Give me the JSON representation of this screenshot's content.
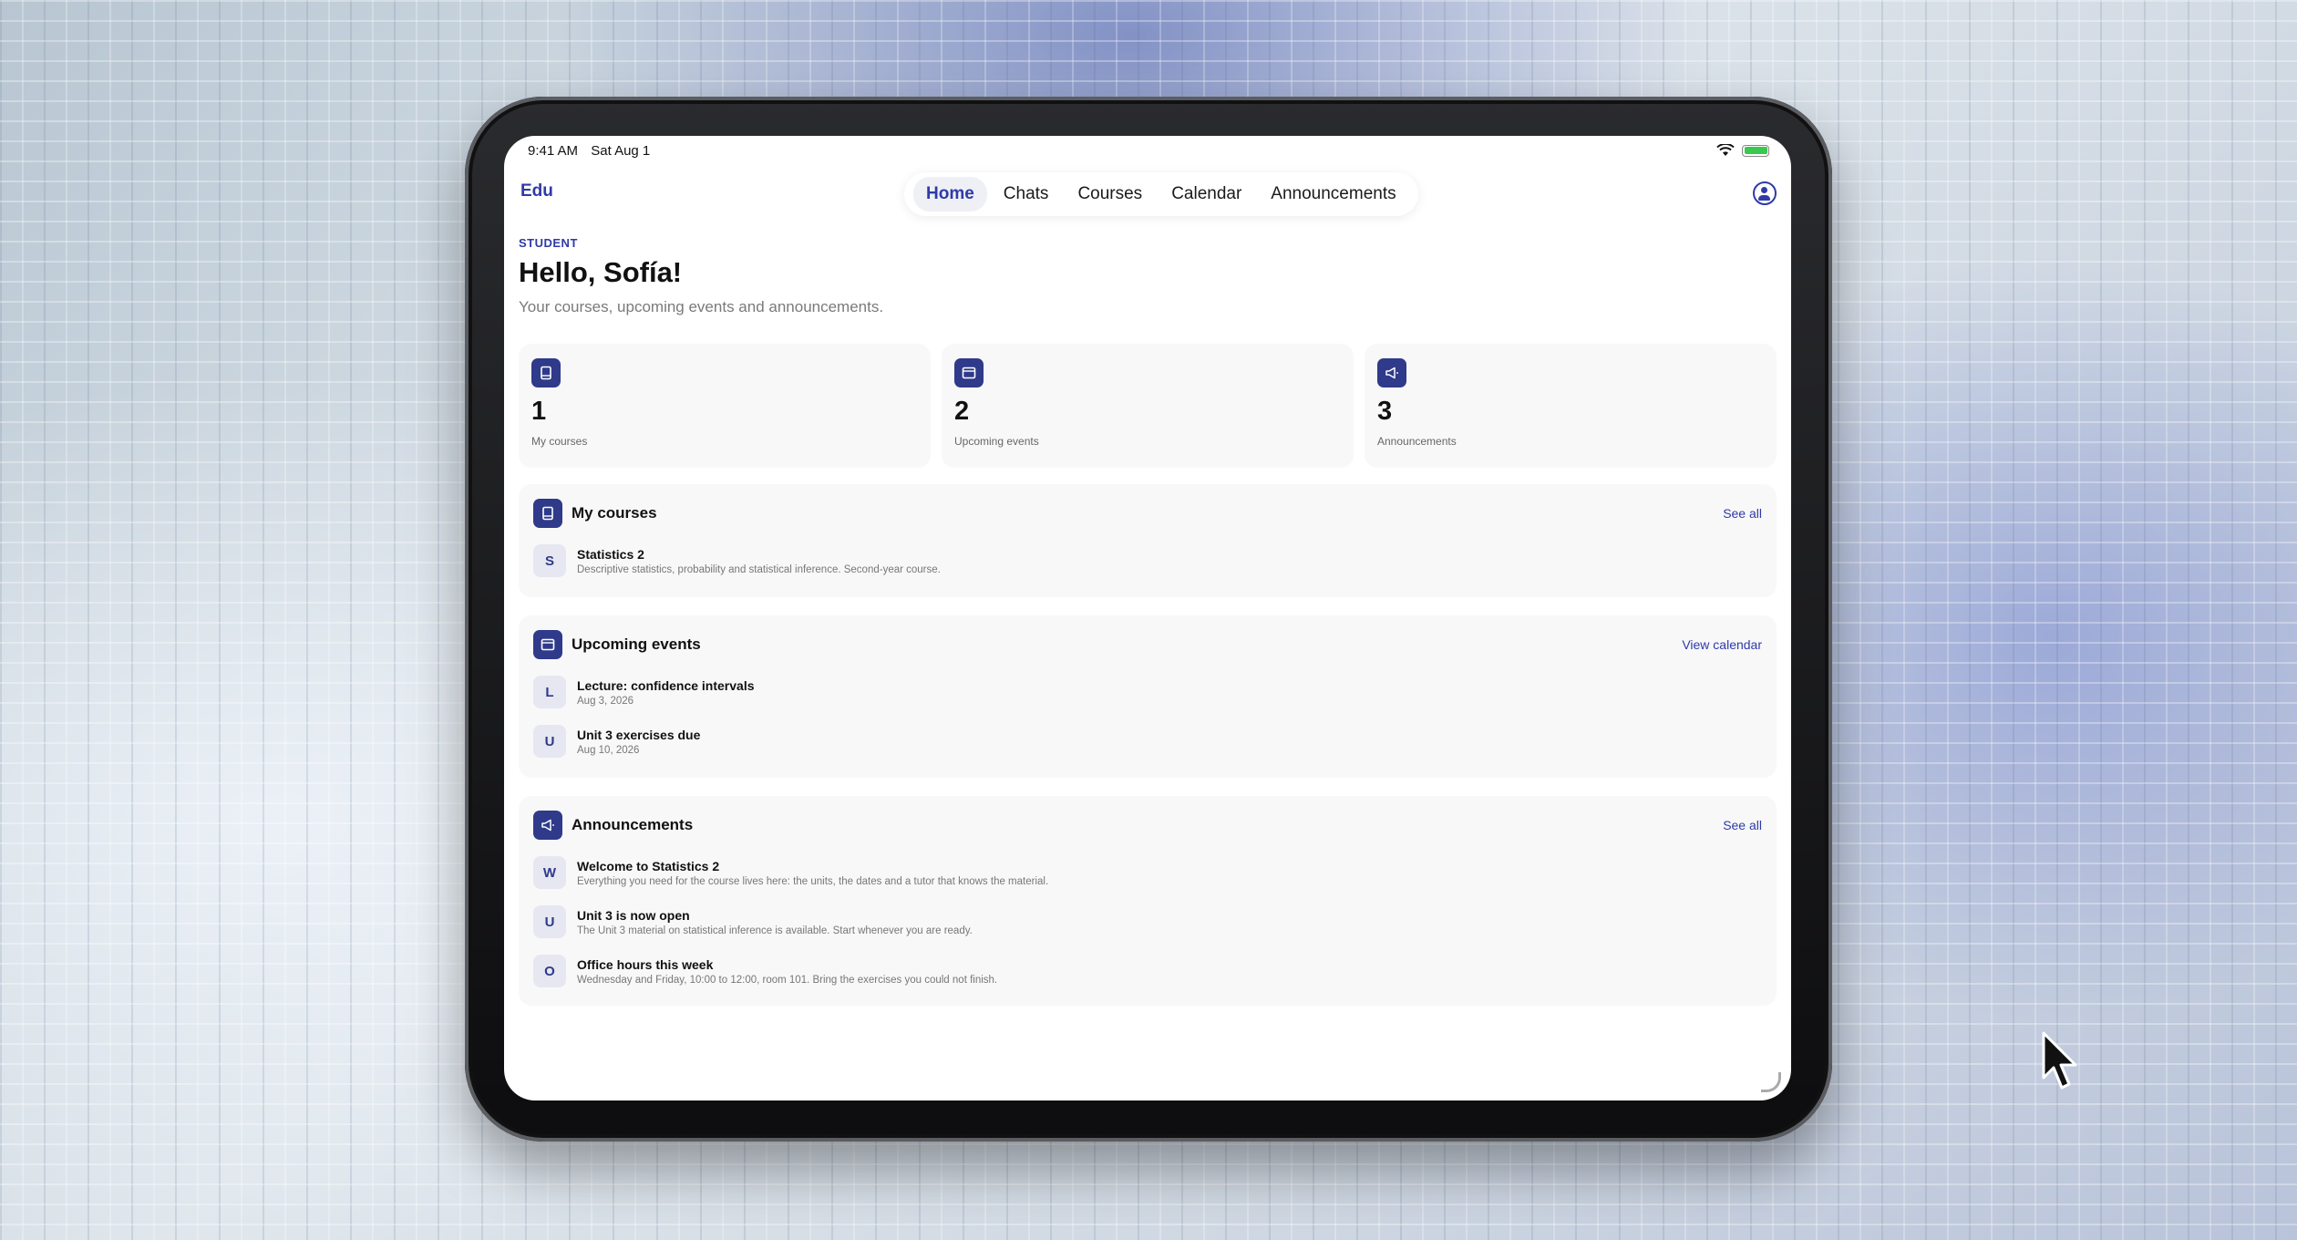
{
  "status_bar": {
    "time": "9:41 AM",
    "date": "Sat Aug 1"
  },
  "app": {
    "brand": "Edu"
  },
  "nav": {
    "tabs": [
      {
        "label": "Home",
        "active": true
      },
      {
        "label": "Chats"
      },
      {
        "label": "Courses"
      },
      {
        "label": "Calendar"
      },
      {
        "label": "Announcements"
      }
    ]
  },
  "header": {
    "role": "STUDENT",
    "greeting": "Hello, Sofía!",
    "subtitle": "Your courses, upcoming events and announcements."
  },
  "stats": [
    {
      "icon": "book-icon",
      "value": "1",
      "label": "My courses"
    },
    {
      "icon": "calendar-icon",
      "value": "2",
      "label": "Upcoming events"
    },
    {
      "icon": "megaphone-icon",
      "value": "3",
      "label": "Announcements"
    }
  ],
  "sections": {
    "courses": {
      "icon": "book-icon",
      "title": "My courses",
      "action": "See all",
      "items": [
        {
          "initial": "S",
          "title": "Statistics 2",
          "detail": "Descriptive statistics, probability and statistical inference. Second-year course."
        }
      ]
    },
    "events": {
      "icon": "calendar-icon",
      "title": "Upcoming events",
      "action": "View calendar",
      "items": [
        {
          "initial": "L",
          "title": "Lecture: confidence intervals",
          "detail": "Aug 3, 2026"
        },
        {
          "initial": "U",
          "title": "Unit 3 exercises due",
          "detail": "Aug 10, 2026"
        }
      ]
    },
    "announcements": {
      "icon": "megaphone-icon",
      "title": "Announcements",
      "action": "See all",
      "items": [
        {
          "initial": "W",
          "title": "Welcome to Statistics 2",
          "detail": "Everything you need for the course lives here: the units, the dates and a tutor that knows the material."
        },
        {
          "initial": "U",
          "title": "Unit 3 is now open",
          "detail": "The Unit 3 material on statistical inference is available. Start whenever you are ready."
        },
        {
          "initial": "O",
          "title": "Office hours this week",
          "detail": "Wednesday and Friday, 10:00 to 12:00, room 101. Bring the exercises you could not finish."
        }
      ]
    }
  },
  "colors": {
    "accent": "#2f3aa8",
    "badge": "#2f3a8a",
    "card": "#f8f8f9"
  }
}
